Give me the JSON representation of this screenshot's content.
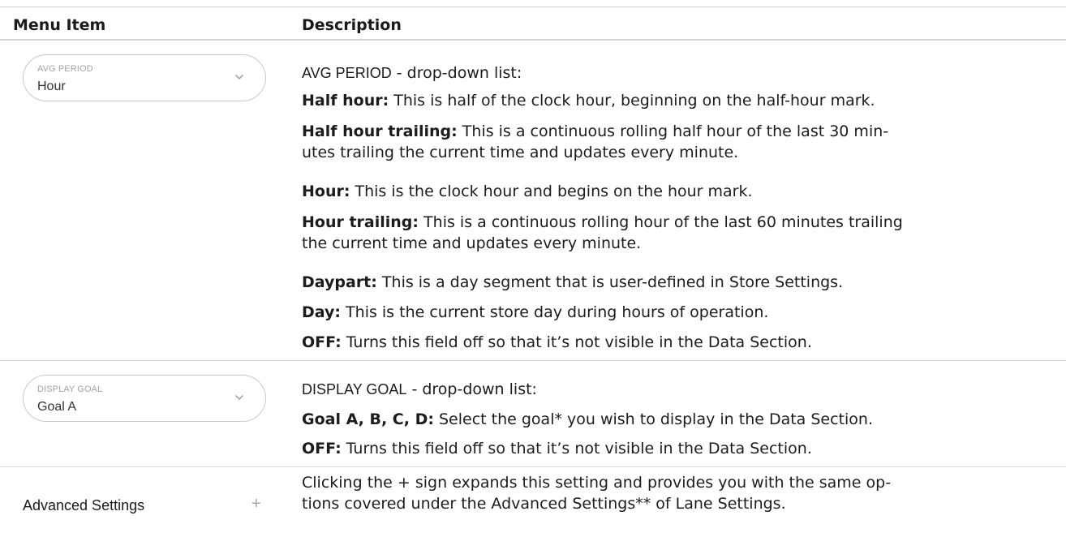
{
  "header": {
    "col_menu_item": "Menu Item",
    "col_description": "Description"
  },
  "rows": [
    {
      "dropdown": {
        "label": "AVG PERIOD",
        "value": "Hour"
      },
      "intro": {
        "name": "AVG PERIOD",
        "rest": " - drop-down list:"
      },
      "entries": [
        {
          "term": "Half hour:",
          "text": " This is half of the clock hour, beginning on the half-hour mark."
        },
        {
          "term": "Half hour trailing:",
          "text": " This is a continuous rolling half hour of the last 30 min-",
          "text2": "utes trailing the current time and updates every minute."
        },
        {
          "term": "Hour:",
          "text": " This is the clock hour and begins on the hour mark."
        },
        {
          "term": "Hour trailing:",
          "text": " This is a continuous rolling hour of the last 60 minutes trailing",
          "text2": "the current time and updates every minute."
        },
        {
          "term": "Daypart:",
          "text": " This is a day segment that is user-defined in Store Settings."
        },
        {
          "term": "Day:",
          "text": " This is the current store day during hours of operation."
        },
        {
          "term": "OFF:",
          "text": " Turns this field off so that it’s not visible in the Data Section."
        }
      ]
    },
    {
      "dropdown": {
        "label": "DISPLAY GOAL",
        "value": "Goal A"
      },
      "intro": {
        "name": "DISPLAY GOAL",
        "rest": " - drop-down list:"
      },
      "entries": [
        {
          "term": "Goal A, B, C, D:",
          "text": " Select the goal* you wish to display in the Data Section."
        },
        {
          "term": "OFF:",
          "text": " Turns this field off so that it’s not visible in the Data Section."
        }
      ]
    },
    {
      "toggle": {
        "label": "Advanced Settings",
        "icon": "plus-icon",
        "symbol": "+"
      },
      "lines": [
        "Clicking the + sign expands this setting and provides you with the same op-",
        "tions covered under the Advanced Settings** of Lane Settings."
      ]
    }
  ]
}
